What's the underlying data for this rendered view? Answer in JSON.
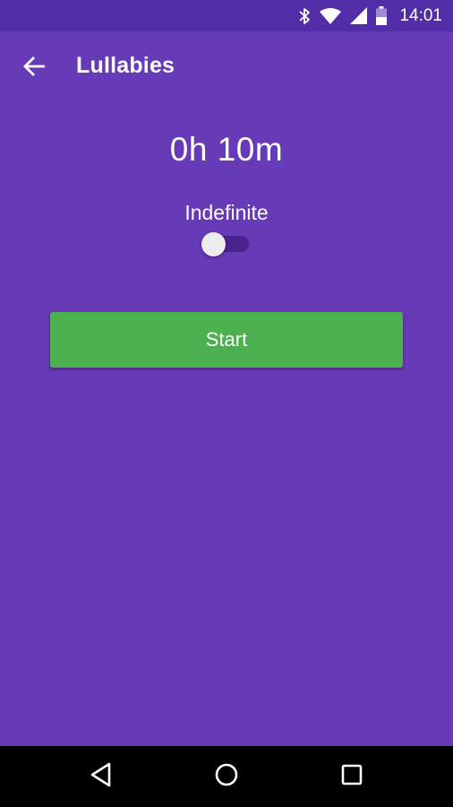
{
  "status_bar": {
    "time": "14:01",
    "icons": [
      "bluetooth-icon",
      "wifi-icon",
      "signal-icon",
      "battery-icon"
    ]
  },
  "app_bar": {
    "title": "Lullabies",
    "back_icon": "arrow-back-icon"
  },
  "timer": {
    "display": "0h 10m"
  },
  "indefinite": {
    "label": "Indefinite",
    "enabled": false
  },
  "start_button": {
    "label": "Start"
  },
  "nav_bar": {
    "icons": [
      "back-triangle-icon",
      "home-circle-icon",
      "recents-square-icon"
    ]
  },
  "colors": {
    "background": "#673ab7",
    "status_bar": "#512da8",
    "start_button": "#4caf50",
    "switch_track": "#4a238f",
    "switch_thumb": "#ececec"
  }
}
